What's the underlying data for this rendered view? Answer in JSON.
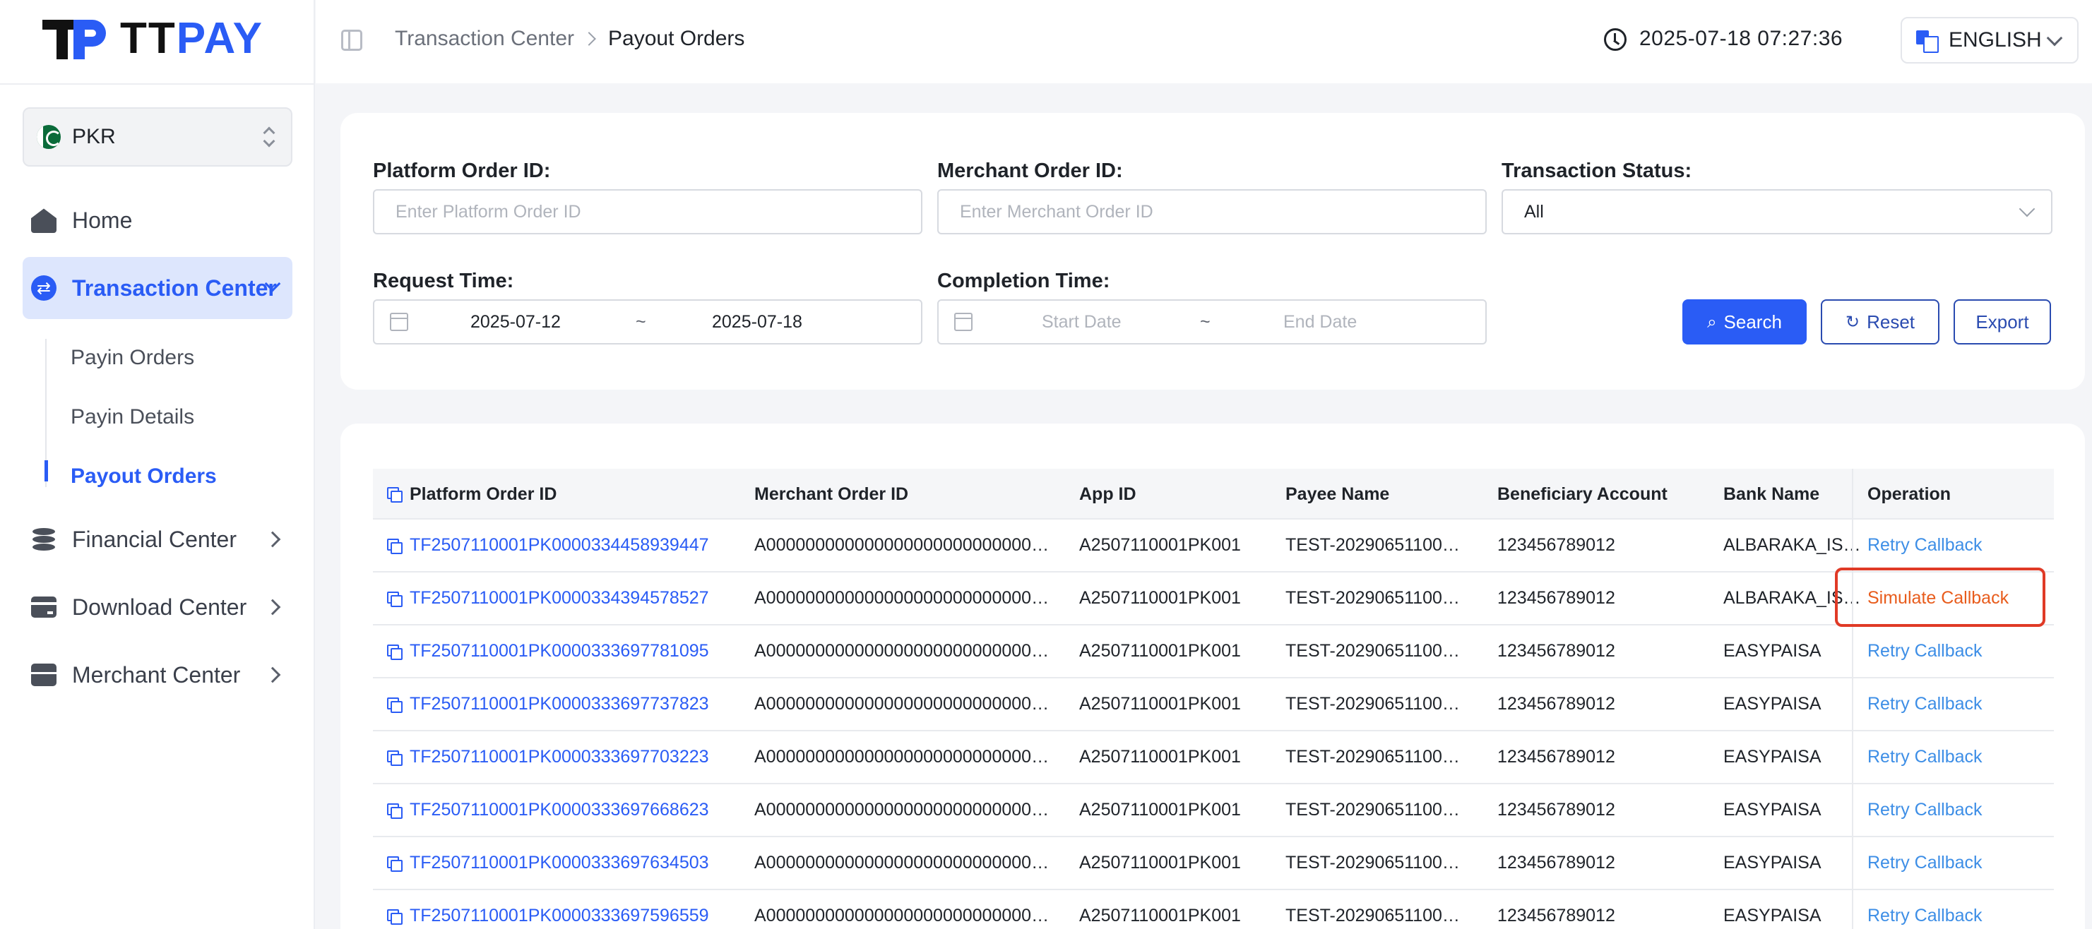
{
  "brand": {
    "logo_text_a": "TT",
    "logo_text_b": "PAY"
  },
  "currency_selector": {
    "value": "PKR"
  },
  "sidebar": {
    "items": [
      {
        "label": "Home"
      },
      {
        "label": "Transaction Center"
      },
      {
        "label": "Financial Center"
      },
      {
        "label": "Download Center"
      },
      {
        "label": "Merchant Center"
      }
    ],
    "sub_items": [
      {
        "label": "Payin Orders"
      },
      {
        "label": "Payin Details"
      },
      {
        "label": "Payout Orders"
      }
    ]
  },
  "header": {
    "breadcrumb_parent": "Transaction Center",
    "breadcrumb_current": "Payout Orders",
    "datetime": "2025-07-18 07:27:36",
    "language": "ENGLISH"
  },
  "filters": {
    "platform_order_id": {
      "label": "Platform Order ID:",
      "placeholder": "Enter Platform Order ID"
    },
    "merchant_order_id": {
      "label": "Merchant Order ID:",
      "placeholder": "Enter Merchant Order ID"
    },
    "transaction_status": {
      "label": "Transaction Status:",
      "value": "All"
    },
    "request_time": {
      "label": "Request Time:",
      "start": "2025-07-12",
      "separator": "~",
      "end": "2025-07-18"
    },
    "completion_time": {
      "label": "Completion Time:",
      "start_placeholder": "Start Date",
      "separator": "~",
      "end_placeholder": "End Date"
    },
    "buttons": {
      "search": "Search",
      "reset": "Reset",
      "export": "Export"
    }
  },
  "table": {
    "columns": [
      "Platform Order ID",
      "Merchant Order ID",
      "App ID",
      "Payee Name",
      "Beneficiary Account",
      "Bank Name",
      "Operation"
    ],
    "rows": [
      {
        "platform_order_id": "TF2507110001PK0000334458939447",
        "merchant_order_id": "A000000000000000000000000000…",
        "app_id": "A2507110001PK001",
        "payee_name": "TEST-20290651100…",
        "beneficiary_account": "123456789012",
        "bank_name": "ALBARAKA_IS…",
        "operation": "Retry Callback"
      },
      {
        "platform_order_id": "TF2507110001PK0000334394578527",
        "merchant_order_id": "A000000000000000000000000000…",
        "app_id": "A2507110001PK001",
        "payee_name": "TEST-20290651100…",
        "beneficiary_account": "123456789012",
        "bank_name": "ALBARAKA_IS…",
        "operation": "Simulate Callback"
      },
      {
        "platform_order_id": "TF2507110001PK0000333697781095",
        "merchant_order_id": "A000000000000000000000000000…",
        "app_id": "A2507110001PK001",
        "payee_name": "TEST-20290651100…",
        "beneficiary_account": "123456789012",
        "bank_name": "EASYPAISA",
        "operation": "Retry Callback"
      },
      {
        "platform_order_id": "TF2507110001PK0000333697737823",
        "merchant_order_id": "A000000000000000000000000000…",
        "app_id": "A2507110001PK001",
        "payee_name": "TEST-20290651100…",
        "beneficiary_account": "123456789012",
        "bank_name": "EASYPAISA",
        "operation": "Retry Callback"
      },
      {
        "platform_order_id": "TF2507110001PK0000333697703223",
        "merchant_order_id": "A000000000000000000000000000…",
        "app_id": "A2507110001PK001",
        "payee_name": "TEST-20290651100…",
        "beneficiary_account": "123456789012",
        "bank_name": "EASYPAISA",
        "operation": "Retry Callback"
      },
      {
        "platform_order_id": "TF2507110001PK0000333697668623",
        "merchant_order_id": "A000000000000000000000000000…",
        "app_id": "A2507110001PK001",
        "payee_name": "TEST-20290651100…",
        "beneficiary_account": "123456789012",
        "bank_name": "EASYPAISA",
        "operation": "Retry Callback"
      },
      {
        "platform_order_id": "TF2507110001PK0000333697634503",
        "merchant_order_id": "A000000000000000000000000000…",
        "app_id": "A2507110001PK001",
        "payee_name": "TEST-20290651100…",
        "beneficiary_account": "123456789012",
        "bank_name": "EASYPAISA",
        "operation": "Retry Callback"
      },
      {
        "platform_order_id": "TF2507110001PK0000333697596559",
        "merchant_order_id": "A000000000000000000000000000…",
        "app_id": "A2507110001PK001",
        "payee_name": "TEST-20290651100…",
        "beneficiary_account": "123456789012",
        "bank_name": "EASYPAISA",
        "operation": "Retry Callback"
      }
    ]
  },
  "colors": {
    "accent": "#2a5cf5",
    "link": "#3d8ee6",
    "simulate": "#e85c1c",
    "highlight": "#e03a26"
  }
}
